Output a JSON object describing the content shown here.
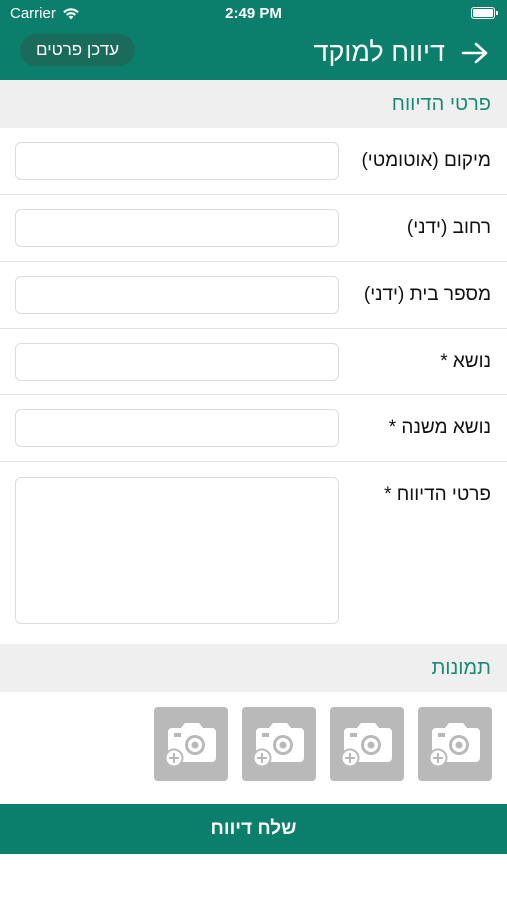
{
  "status": {
    "carrier": "Carrier",
    "time": "2:49 PM"
  },
  "nav": {
    "title": "דיווח למוקד",
    "update_button": "עדכן פרטים"
  },
  "sections": {
    "details": "פרטי הדיווח",
    "photos": "תמונות"
  },
  "form": {
    "location": {
      "label": "מיקום (אוטומטי)",
      "value": ""
    },
    "street": {
      "label": "רחוב (ידני)",
      "value": ""
    },
    "house_number": {
      "label": "מספר בית (ידני)",
      "value": ""
    },
    "subject": {
      "label": "נושא *",
      "value": ""
    },
    "sub_subject": {
      "label": "נושא משנה *",
      "value": ""
    },
    "details": {
      "label": "פרטי הדיווח *",
      "value": ""
    }
  },
  "photo_slots": [
    "add-photo",
    "add-photo",
    "add-photo",
    "add-photo"
  ],
  "send_button": "שלח דיווח",
  "colors": {
    "primary": "#0b7f6b",
    "section_text": "#1a8a76",
    "section_bg": "#efefef",
    "photo_bg": "#b9b9b9"
  }
}
